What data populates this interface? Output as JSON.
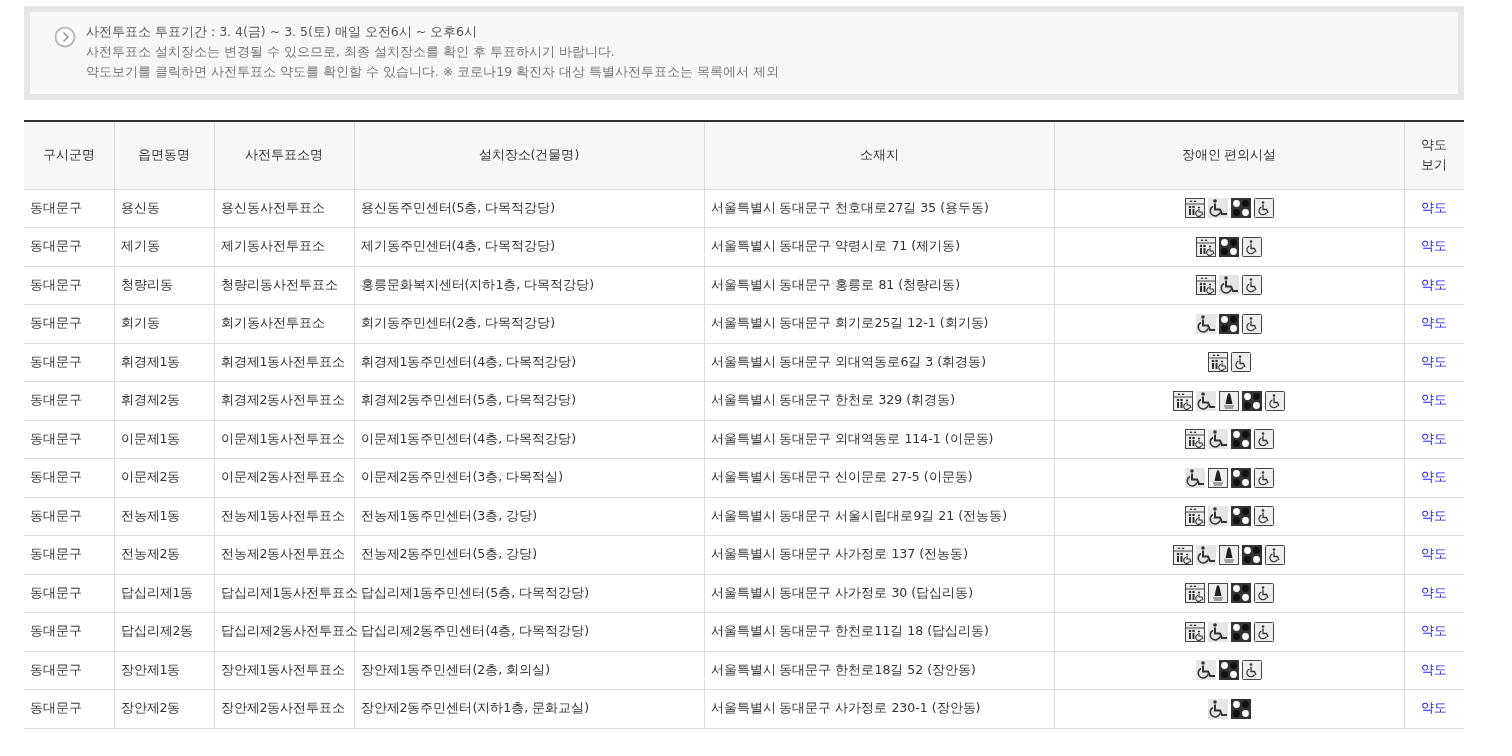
{
  "notice": {
    "lines": [
      "사전투표소 투표기간 : 3. 4(금) ~ 3. 5(토) 매일 오전6시 ~ 오후6시",
      "사전투표소 설치장소는 변경될 수 있으므로, 최종 설치장소를 확인 후 투표하시기 바랍니다.",
      "약도보기를 클릭하면 사전투표소 약도를 확인할 수 있습니다. ※ 코로나19 확진자 대상 특별사전투표소는 목록에서 제외"
    ]
  },
  "table": {
    "columns": [
      "구시군명",
      "읍면동명",
      "사전투표소명",
      "설치장소(건물명)",
      "소재지",
      "장애인 편의시설",
      "약도보기"
    ],
    "rows": [
      {
        "district": "동대문구",
        "dong": "용신동",
        "station": "용신동사전투표소",
        "place": "용신동주민센터(5층, 다목적강당)",
        "address": "서울특별시 동대문구 천호대로27길 35 (용두동)",
        "facilities": [
          {
            "kind": "elevator"
          },
          {
            "kind": "ramp"
          },
          {
            "kind": "braille"
          },
          {
            "kind": "toilet"
          }
        ],
        "map": "약도"
      },
      {
        "district": "동대문구",
        "dong": "제기동",
        "station": "제기동사전투표소",
        "place": "제기동주민센터(4층, 다목적강당)",
        "address": "서울특별시 동대문구 약령시로 71 (제기동)",
        "facilities": [
          {
            "kind": "elevator"
          },
          {
            "kind": "braille"
          },
          {
            "kind": "toilet"
          }
        ],
        "map": "약도"
      },
      {
        "district": "동대문구",
        "dong": "청량리동",
        "station": "청량리동사전투표소",
        "place": "홍릉문화복지센터(지하1층, 다목적강당)",
        "address": "서울특별시 동대문구 홍릉로 81 (청량리동)",
        "facilities": [
          {
            "kind": "elevator"
          },
          {
            "kind": "ramp"
          },
          {
            "kind": "toilet"
          }
        ],
        "map": "약도"
      },
      {
        "district": "동대문구",
        "dong": "회기동",
        "station": "회기동사전투표소",
        "place": "회기동주민센터(2층, 다목적강당)",
        "address": "서울특별시 동대문구 회기로25길 12-1 (회기동)",
        "facilities": [
          {
            "kind": "ramp"
          },
          {
            "kind": "braille"
          },
          {
            "kind": "toilet"
          }
        ],
        "map": "약도"
      },
      {
        "district": "동대문구",
        "dong": "휘경제1동",
        "station": "휘경제1동사전투표소",
        "place": "휘경제1동주민센터(4층, 다목적강당)",
        "address": "서울특별시 동대문구 외대역동로6길 3 (휘경동)",
        "facilities": [
          {
            "kind": "elevator"
          },
          {
            "kind": "toilet"
          }
        ],
        "map": "약도"
      },
      {
        "district": "동대문구",
        "dong": "휘경제2동",
        "station": "휘경제2동사전투표소",
        "place": "휘경제2동주민센터(5층, 다목적강당)",
        "address": "서울특별시 동대문구 한천로 329 (휘경동)",
        "facilities": [
          {
            "kind": "elevator"
          },
          {
            "kind": "ramp"
          },
          {
            "kind": "lift"
          },
          {
            "kind": "braille"
          },
          {
            "kind": "toilet"
          }
        ],
        "map": "약도"
      },
      {
        "district": "동대문구",
        "dong": "이문제1동",
        "station": "이문제1동사전투표소",
        "place": "이문제1동주민센터(4층, 다목적강당)",
        "address": "서울특별시 동대문구 외대역동로 114-1 (이문동)",
        "facilities": [
          {
            "kind": "elevator"
          },
          {
            "kind": "ramp"
          },
          {
            "kind": "braille"
          },
          {
            "kind": "toilet"
          }
        ],
        "map": "약도"
      },
      {
        "district": "동대문구",
        "dong": "이문제2동",
        "station": "이문제2동사전투표소",
        "place": "이문제2동주민센터(3층, 다목적실)",
        "address": "서울특별시 동대문구 신이문로 27-5 (이문동)",
        "facilities": [
          {
            "kind": "ramp"
          },
          {
            "kind": "lift"
          },
          {
            "kind": "braille"
          },
          {
            "kind": "toilet"
          }
        ],
        "map": "약도"
      },
      {
        "district": "동대문구",
        "dong": "전농제1동",
        "station": "전농제1동사전투표소",
        "place": "전농제1동주민센터(3층, 강당)",
        "address": "서울특별시 동대문구 서울시립대로9길 21 (전농동)",
        "facilities": [
          {
            "kind": "elevator"
          },
          {
            "kind": "ramp"
          },
          {
            "kind": "braille"
          },
          {
            "kind": "toilet"
          }
        ],
        "map": "약도"
      },
      {
        "district": "동대문구",
        "dong": "전농제2동",
        "station": "전농제2동사전투표소",
        "place": "전농제2동주민센터(5층, 강당)",
        "address": "서울특별시 동대문구 사가정로 137 (전농동)",
        "facilities": [
          {
            "kind": "elevator"
          },
          {
            "kind": "ramp"
          },
          {
            "kind": "lift"
          },
          {
            "kind": "braille"
          },
          {
            "kind": "toilet"
          }
        ],
        "map": "약도"
      },
      {
        "district": "동대문구",
        "dong": "답십리제1동",
        "station": "답십리제1동사전투표소",
        "place": "답십리제1동주민센터(5층, 다목적강당)",
        "address": "서울특별시 동대문구 사가정로 30 (답십리동)",
        "facilities": [
          {
            "kind": "elevator"
          },
          {
            "kind": "lift"
          },
          {
            "kind": "braille"
          },
          {
            "kind": "toilet"
          }
        ],
        "map": "약도"
      },
      {
        "district": "동대문구",
        "dong": "답십리제2동",
        "station": "답십리제2동사전투표소",
        "place": "답십리제2동주민센터(4층, 다목적강당)",
        "address": "서울특별시 동대문구 한천로11길 18 (답십리동)",
        "facilities": [
          {
            "kind": "elevator"
          },
          {
            "kind": "ramp"
          },
          {
            "kind": "braille"
          },
          {
            "kind": "toilet"
          }
        ],
        "map": "약도"
      },
      {
        "district": "동대문구",
        "dong": "장안제1동",
        "station": "장안제1동사전투표소",
        "place": "장안제1동주민센터(2층, 회의실)",
        "address": "서울특별시 동대문구 한천로18길 52 (장안동)",
        "facilities": [
          {
            "kind": "ramp"
          },
          {
            "kind": "braille"
          },
          {
            "kind": "toilet"
          }
        ],
        "map": "약도"
      },
      {
        "district": "동대문구",
        "dong": "장안제2동",
        "station": "장안제2동사전투표소",
        "place": "장안제2동주민센터(지하1층, 문화교실)",
        "address": "서울특별시 동대문구 사가정로 230-1 (장안동)",
        "facilities": [
          {
            "kind": "ramp"
          },
          {
            "kind": "braille"
          }
        ],
        "map": "약도"
      }
    ]
  }
}
